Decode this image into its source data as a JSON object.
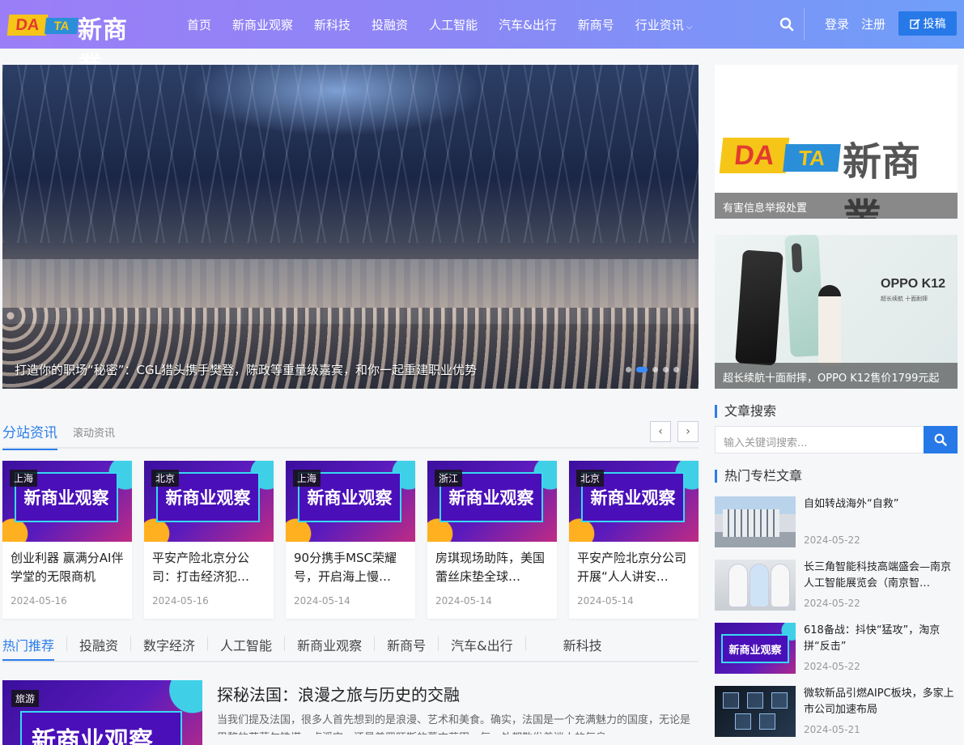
{
  "header": {
    "logo": {
      "da": "DA",
      "ta": "TA",
      "cn": "新商業"
    },
    "nav": [
      "首页",
      "新商业观察",
      "新科技",
      "投融资",
      "人工智能",
      "汽车&出行",
      "新商号"
    ],
    "nav_dropdown": "行业资讯",
    "login": "登录",
    "register": "注册",
    "submit": "投稿"
  },
  "hero": {
    "caption": "打造你的职场“秘密”：CGL猎头携手樊登，陈政等重量级嘉宾，和你一起重建职业优势"
  },
  "ads": [
    {
      "caption": "有害信息举报处置",
      "logo": {
        "da": "DA",
        "ta": "TA",
        "cn": "新商業"
      }
    },
    {
      "caption": "超长续航十面耐摔，OPPO K12售价1799元起",
      "brand": "OPPO K12",
      "sub": "超长续航 十面耐摔"
    }
  ],
  "branch": {
    "title": "分站资讯",
    "subtitle": "滚动资讯",
    "prev": "‹",
    "next": "›",
    "cards": [
      {
        "tag": "上海",
        "thumb_text": "新商业观察",
        "title": "创业利器 赢满分AI伴学堂的无限商机",
        "date": "2024-05-16"
      },
      {
        "tag": "北京",
        "thumb_text": "新商业观察",
        "title": "平安产险北京分公司：打击经济犯…",
        "date": "2024-05-16"
      },
      {
        "tag": "上海",
        "thumb_text": "新商业观察",
        "title": "90分携手MSC荣耀号，开启海上慢…",
        "date": "2024-05-14"
      },
      {
        "tag": "浙江",
        "thumb_text": "新商业观察",
        "title": "房琪现场助阵，美国蕾丝床垫全球…",
        "date": "2024-05-14"
      },
      {
        "tag": "北京",
        "thumb_text": "新商业观察",
        "title": "平安产险北京分公司开展“人人讲安…",
        "date": "2024-05-14"
      }
    ]
  },
  "tabs": [
    "热门推荐",
    "投融资",
    "数字经济",
    "人工智能",
    "新商业观察",
    "新商号",
    "汽车&出行",
    "新科技"
  ],
  "featured": {
    "tag": "旅游",
    "thumb_text": "新商业观察",
    "title": "探秘法国：浪漫之旅与历史的交融",
    "summary": "当我们提及法国，很多人首先想到的是浪漫、艺术和美食。确实，法国是一个充满魅力的国度，无论是巴黎的艾菲尔铁塔，卢浮宫，还是普罗旺斯的薰衣草田，每一处都散发着迷人的气息。"
  },
  "sidebar": {
    "search_title": "文章搜索",
    "search_placeholder": "输入关键词搜索...",
    "hot_title": "热门专栏文章",
    "hot": [
      {
        "title": "自如转战海外“自救”",
        "date": "2024-05-22"
      },
      {
        "title": "长三角智能科技高端盛会—南京人工智能展览会（南京智…",
        "date": "2024-05-22"
      },
      {
        "title": "618备战：抖快“猛攻”，淘京拼“反击”",
        "date": "2024-05-22",
        "thumb_text": "新商业观察"
      },
      {
        "title": "微软新品引燃AIPC板块，多家上市公司加速布局",
        "date": "2024-05-21"
      }
    ]
  },
  "colors": {
    "accent": "#2b7de9",
    "header_start": "#9b7ef7",
    "header_end": "#6f9ff8"
  }
}
